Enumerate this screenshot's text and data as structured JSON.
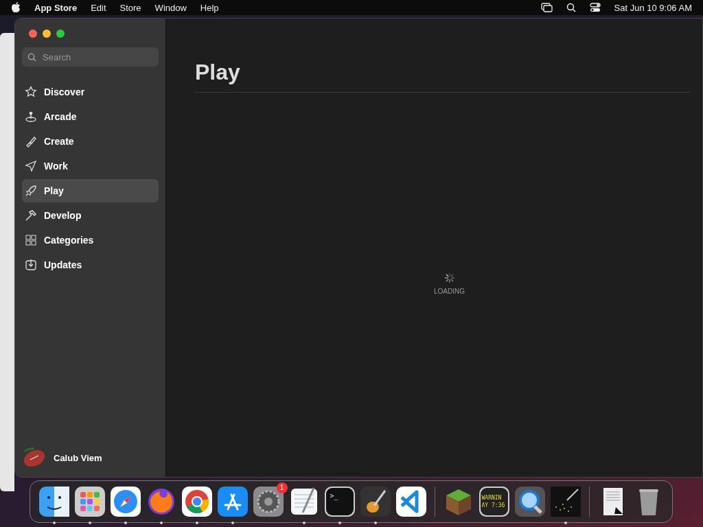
{
  "menu_bar": {
    "app_name": "App Store",
    "menus": [
      "Edit",
      "Store",
      "Window",
      "Help"
    ],
    "clock": "Sat Jun 10  9:06 AM"
  },
  "sidebar": {
    "search": {
      "placeholder": "Search"
    },
    "items": [
      {
        "label": "Discover",
        "selected": false
      },
      {
        "label": "Arcade",
        "selected": false
      },
      {
        "label": "Create",
        "selected": false
      },
      {
        "label": "Work",
        "selected": false
      },
      {
        "label": "Play",
        "selected": true
      },
      {
        "label": "Develop",
        "selected": false
      },
      {
        "label": "Categories",
        "selected": false
      },
      {
        "label": "Updates",
        "selected": false
      }
    ],
    "account": {
      "name": "Calub Viem"
    }
  },
  "content": {
    "title": "Play",
    "status": "LOADING"
  },
  "dock": {
    "items": [
      {
        "kind": "finder",
        "running": true
      },
      {
        "kind": "launchpad",
        "running": true
      },
      {
        "kind": "safari",
        "running": true
      },
      {
        "kind": "firefox",
        "running": true
      },
      {
        "kind": "chrome",
        "running": true
      },
      {
        "kind": "appstore",
        "running": true
      },
      {
        "kind": "settings",
        "running": false,
        "badge": "1"
      },
      {
        "kind": "textedit",
        "running": true
      },
      {
        "kind": "terminal",
        "running": true,
        "text": ">_"
      },
      {
        "kind": "guitar",
        "running": true
      },
      {
        "kind": "vscode",
        "running": false
      },
      {
        "kind": "divider"
      },
      {
        "kind": "minecraft",
        "running": false
      },
      {
        "kind": "console",
        "running": false,
        "lines": [
          "WARNIN",
          "AY 7:36"
        ]
      },
      {
        "kind": "quicktime",
        "running": false
      },
      {
        "kind": "stars",
        "running": true
      },
      {
        "kind": "divider"
      },
      {
        "kind": "document",
        "running": false
      },
      {
        "kind": "trash",
        "running": false
      }
    ]
  }
}
